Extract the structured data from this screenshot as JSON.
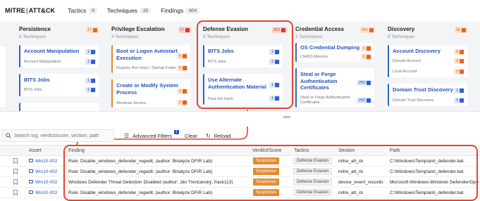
{
  "app": {
    "logo_left": "MITRE",
    "logo_sep": "|",
    "logo_right": "ATT&CK",
    "tabs": [
      {
        "label": "Tactics",
        "count": "9"
      },
      {
        "label": "Techniques",
        "count": "35"
      },
      {
        "label": "Findings",
        "count": "604"
      }
    ]
  },
  "matrix": {
    "columns": [
      {
        "title": "Persistence",
        "subtitle": "6 Techniques",
        "badge": "17",
        "cards": [
          {
            "title": "Account Manipulation",
            "sub": "Account Manipulation",
            "count": "1"
          },
          {
            "title": "BITS Jobs",
            "sub": "BITS Jobs",
            "count": "1"
          }
        ]
      },
      {
        "title": "Privilege Escalation",
        "subtitle": "4 Techniques",
        "badge": "17",
        "cards": [
          {
            "title": "Boot or Logon Autostart Execution",
            "sub": "Registry Run Keys / Startup Folder",
            "count": "6"
          },
          {
            "title": "Create or Modify System Process",
            "sub": "Windows Service",
            "count": "3",
            "count2": "2"
          }
        ]
      },
      {
        "title": "Defense Evasion",
        "subtitle": "9 Techniques",
        "badge": "253",
        "cards": [
          {
            "title": "BITS Jobs",
            "sub": "BITS Jobs",
            "count": "1"
          },
          {
            "title": "Use Alternate Authentication Material",
            "sub": "Pass the Hash",
            "count": "1"
          }
        ]
      },
      {
        "title": "Credential Access",
        "subtitle": "2 Techniques",
        "badge": "251",
        "cards": [
          {
            "title": "OS Credential Dumping",
            "sub": "LSASS Memory",
            "count": "1"
          },
          {
            "title": "Steal or Forge Authentication Certificates",
            "sub": "Steal or Forge Authentication Certificates",
            "count": "250"
          }
        ]
      },
      {
        "title": "Discovery",
        "subtitle": "9 Techniques",
        "badge": "10",
        "cards": [
          {
            "title": "Account Discovery",
            "sub": "Domain Account",
            "sub2": "Local Account",
            "count": "9",
            "count2": "3"
          },
          {
            "title": "Domain Trust Discovery",
            "sub": "Domain Trust Discovery",
            "count": "1"
          }
        ]
      }
    ]
  },
  "toolbar": {
    "search_placeholder": "Search log, verdict/score, section, path",
    "advanced_filters_label": "Advanced Filters",
    "filter_count": "1",
    "clear_label": "Clear",
    "reload_label": "Reload"
  },
  "table": {
    "headers": [
      "Asset",
      "Finding",
      "Verdict/Score",
      "Tactics",
      "Section",
      "Path"
    ],
    "rows": [
      {
        "asset": "Win10-002",
        "finding": "Rule: Disable_windows_defender_regedit, (author: Binalyze DFIR Lab)",
        "verdict": "Suspicious",
        "tactic": "Defense Evasion",
        "section": "mitre_att_ck",
        "path": "C:\\Windows\\Temp\\anti_defender.bat"
      },
      {
        "asset": "Win10-002",
        "finding": "Rule: Disable_windows_defender_regedit, (author: Binalyze DFIR Lab)",
        "verdict": "Suspicious",
        "tactic": "Defense Evasion",
        "section": "mitre_att_ck",
        "path": "C:\\Windows\\Temp\\anti_defender.bat"
      },
      {
        "asset": "Win10-002",
        "finding": "Windows Defender Threat Detection Disabled (author: Ján Trenčanský, frack113)",
        "verdict": "Suspicious",
        "tactic": "Defense Evasion",
        "section": "device_event_records",
        "path": "Microsoft-Windows-Windows Defender/Ope"
      },
      {
        "asset": "Win10-002",
        "finding": "Rule: Disable_windows_defender_regedit, (author: Binalyze DFIR Lab)",
        "verdict": "Suspicious",
        "tactic": "Defense Evasion",
        "section": "mitre_att_ck",
        "path": "C:\\Windows\\Temp\\anti_defender.bat"
      }
    ]
  },
  "colors": {
    "accent_blue": "#2752b8",
    "verdict_orange": "#e38a31",
    "highlight_red": "#e8432f"
  }
}
